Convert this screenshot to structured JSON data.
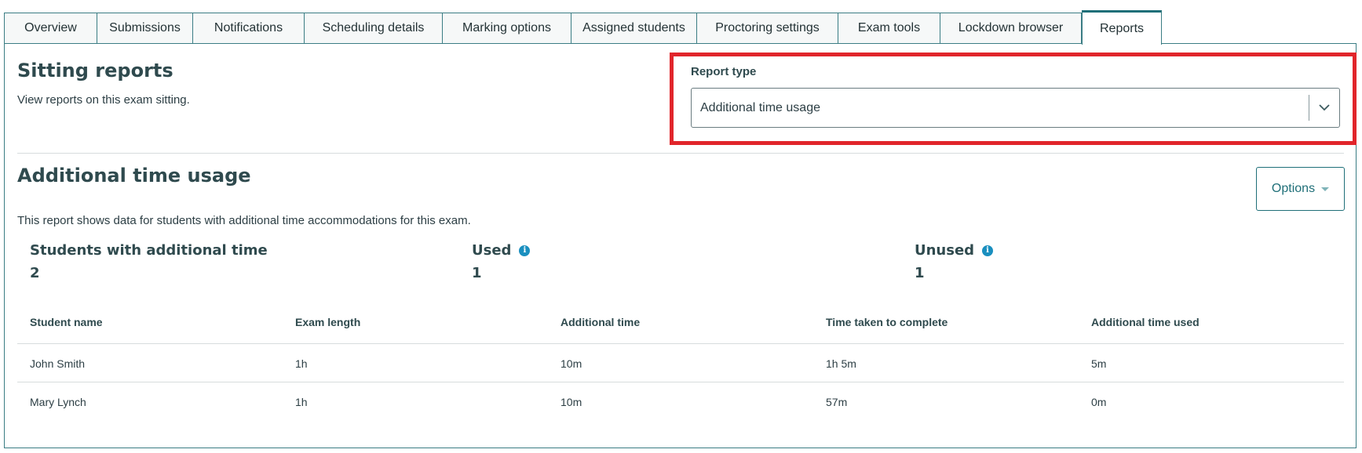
{
  "tabs": [
    {
      "label": "Overview"
    },
    {
      "label": "Submissions"
    },
    {
      "label": "Notifications"
    },
    {
      "label": "Scheduling details"
    },
    {
      "label": "Marking options"
    },
    {
      "label": "Assigned students"
    },
    {
      "label": "Proctoring settings"
    },
    {
      "label": "Exam tools"
    },
    {
      "label": "Lockdown browser"
    },
    {
      "label": "Reports",
      "active": true
    }
  ],
  "header": {
    "title": "Sitting reports",
    "description": "View reports on this exam sitting."
  },
  "report_type": {
    "label": "Report type",
    "selected": "Additional time usage"
  },
  "report": {
    "title": "Additional time usage",
    "description": "This report shows data for students with additional time accommodations for this exam.",
    "options_label": "Options"
  },
  "stats": [
    {
      "label": "Students with additional time",
      "value": "2",
      "info": false
    },
    {
      "label": "Used",
      "value": "1",
      "info": true
    },
    {
      "label": "Unused",
      "value": "1",
      "info": true
    }
  ],
  "table": {
    "columns": [
      "Student name",
      "Exam length",
      "Additional time",
      "Time taken to complete",
      "Additional time used"
    ],
    "rows": [
      [
        "John Smith",
        "1h",
        "10m",
        "1h 5m",
        "5m"
      ],
      [
        "Mary Lynch",
        "1h",
        "10m",
        "57m",
        "0m"
      ]
    ]
  },
  "colors": {
    "accent": "#1f6f78",
    "highlight": "#e1252b",
    "info": "#1a8fbf"
  }
}
